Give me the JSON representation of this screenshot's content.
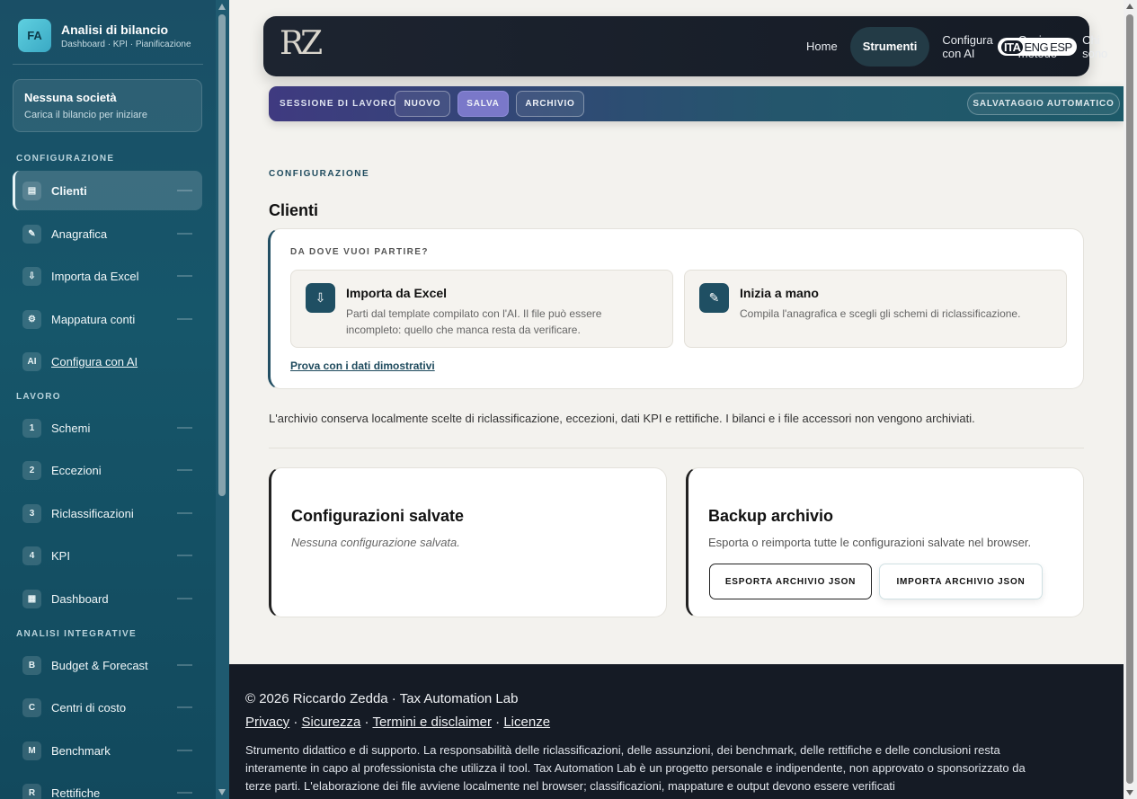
{
  "sidebar": {
    "brand": {
      "badge": "FA",
      "title": "Analisi di bilancio",
      "subtitle": "Dashboard · KPI · Pianificazione"
    },
    "company": {
      "name": "Nessuna società",
      "hint": "Carica il bilancio per iniziare"
    },
    "sections": [
      "CONFIGURAZIONE",
      "LAVORO",
      "ANALISI INTEGRATIVE"
    ],
    "config_items": [
      {
        "icon": "▤",
        "label": "Clienti"
      },
      {
        "icon": "✎",
        "label": "Anagrafica"
      },
      {
        "icon": "⇩",
        "label": "Importa da Excel"
      },
      {
        "icon": "⚙",
        "label": "Mappatura conti"
      },
      {
        "icon": "AI",
        "label": "Configura con AI"
      }
    ],
    "work_items": [
      {
        "icon": "1",
        "label": "Schemi"
      },
      {
        "icon": "2",
        "label": "Eccezioni"
      },
      {
        "icon": "3",
        "label": "Riclassificazioni"
      },
      {
        "icon": "4",
        "label": "KPI"
      },
      {
        "icon": "▦",
        "label": "Dashboard"
      }
    ],
    "extra_items": [
      {
        "icon": "B",
        "label": "Budget & Forecast"
      },
      {
        "icon": "C",
        "label": "Centri di costo"
      },
      {
        "icon": "M",
        "label": "Benchmark"
      },
      {
        "icon": "R",
        "label": "Rettifiche"
      }
    ]
  },
  "topnav": {
    "logo": "RZ",
    "links": [
      "Home",
      "Strumenti",
      "Configura con AI",
      "Casi e metodo",
      "Chi sono"
    ],
    "languages": [
      "ITA",
      "ENG",
      "ESP"
    ]
  },
  "session": {
    "label": "SESSIONE DI LAVORO",
    "buttons": [
      "NUOVO",
      "SALVA",
      "ARCHIVIO"
    ],
    "autosave": "SALVATAGGIO AUTOMATICO"
  },
  "content": {
    "eyebrow": "CONFIGURAZIONE",
    "title": "Clienti",
    "start": {
      "question": "DA DOVE VUOI PARTIRE?",
      "options": [
        {
          "icon": "⇩",
          "title": "Importa da Excel",
          "desc": "Parti dal template compilato con l'AI. Il file può essere incompleto: quello che manca resta da verificare."
        },
        {
          "icon": "✎",
          "title": "Inizia a mano",
          "desc": "Compila l'anagrafica e scegli gli schemi di riclassificazione."
        }
      ],
      "demo_link": "Prova con i dati dimostrativi"
    },
    "archive_note": "L'archivio conserva localmente scelte di riclassificazione, eccezioni, dati KPI e rettifiche. I bilanci e i file accessori non vengono archiviati.",
    "saved": {
      "title": "Configurazioni salvate",
      "empty": "Nessuna configurazione salvata."
    },
    "backup": {
      "title": "Backup archivio",
      "desc": "Esporta o reimporta tutte le configurazioni salvate nel browser.",
      "export_label": "ESPORTA ARCHIVIO JSON",
      "import_label": "IMPORTA ARCHIVIO JSON"
    }
  },
  "footer": {
    "copyright": "© 2026 Riccardo Zedda · Tax Automation Lab",
    "links": [
      "Privacy",
      "Sicurezza",
      "Termini e disclaimer",
      "Licenze"
    ],
    "disclaimer": "Strumento didattico e di supporto. La responsabilità delle riclassificazioni, delle assunzioni, dei benchmark, delle rettifiche e delle conclusioni resta interamente in capo al professionista che utilizza il tool. Tax Automation Lab è un progetto personale e indipendente, non approvato o sponsorizzato da terze parti. L'elaborazione dei file avviene localmente nel browser; classificazioni, mappature e output devono essere verificati"
  }
}
